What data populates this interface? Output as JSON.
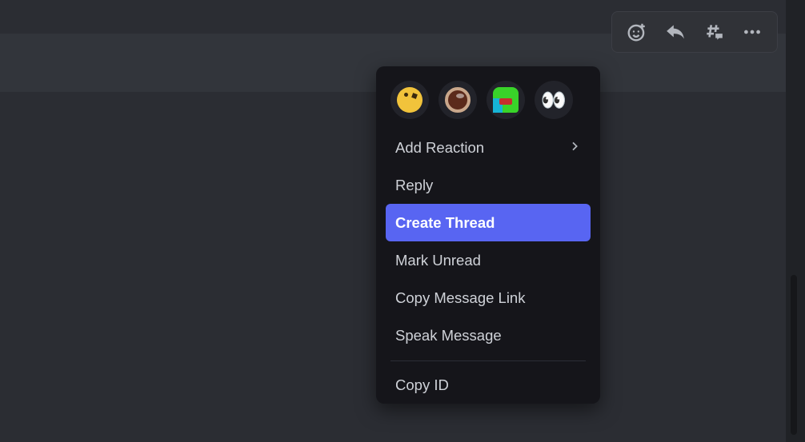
{
  "toolbar": {
    "add_reaction_label": "Add Reaction",
    "reply_label": "Reply",
    "thread_label": "Create Thread",
    "more_label": "More"
  },
  "quick_emoji": [
    {
      "name": "thinking-face"
    },
    {
      "name": "coffee-ring"
    },
    {
      "name": "pepe-laugh"
    },
    {
      "name": "eyes",
      "glyph": "👀"
    }
  ],
  "menu": {
    "add_reaction": "Add Reaction",
    "reply": "Reply",
    "create_thread": "Create Thread",
    "mark_unread": "Mark Unread",
    "copy_link": "Copy Message Link",
    "speak": "Speak Message",
    "copy_id": "Copy ID"
  }
}
